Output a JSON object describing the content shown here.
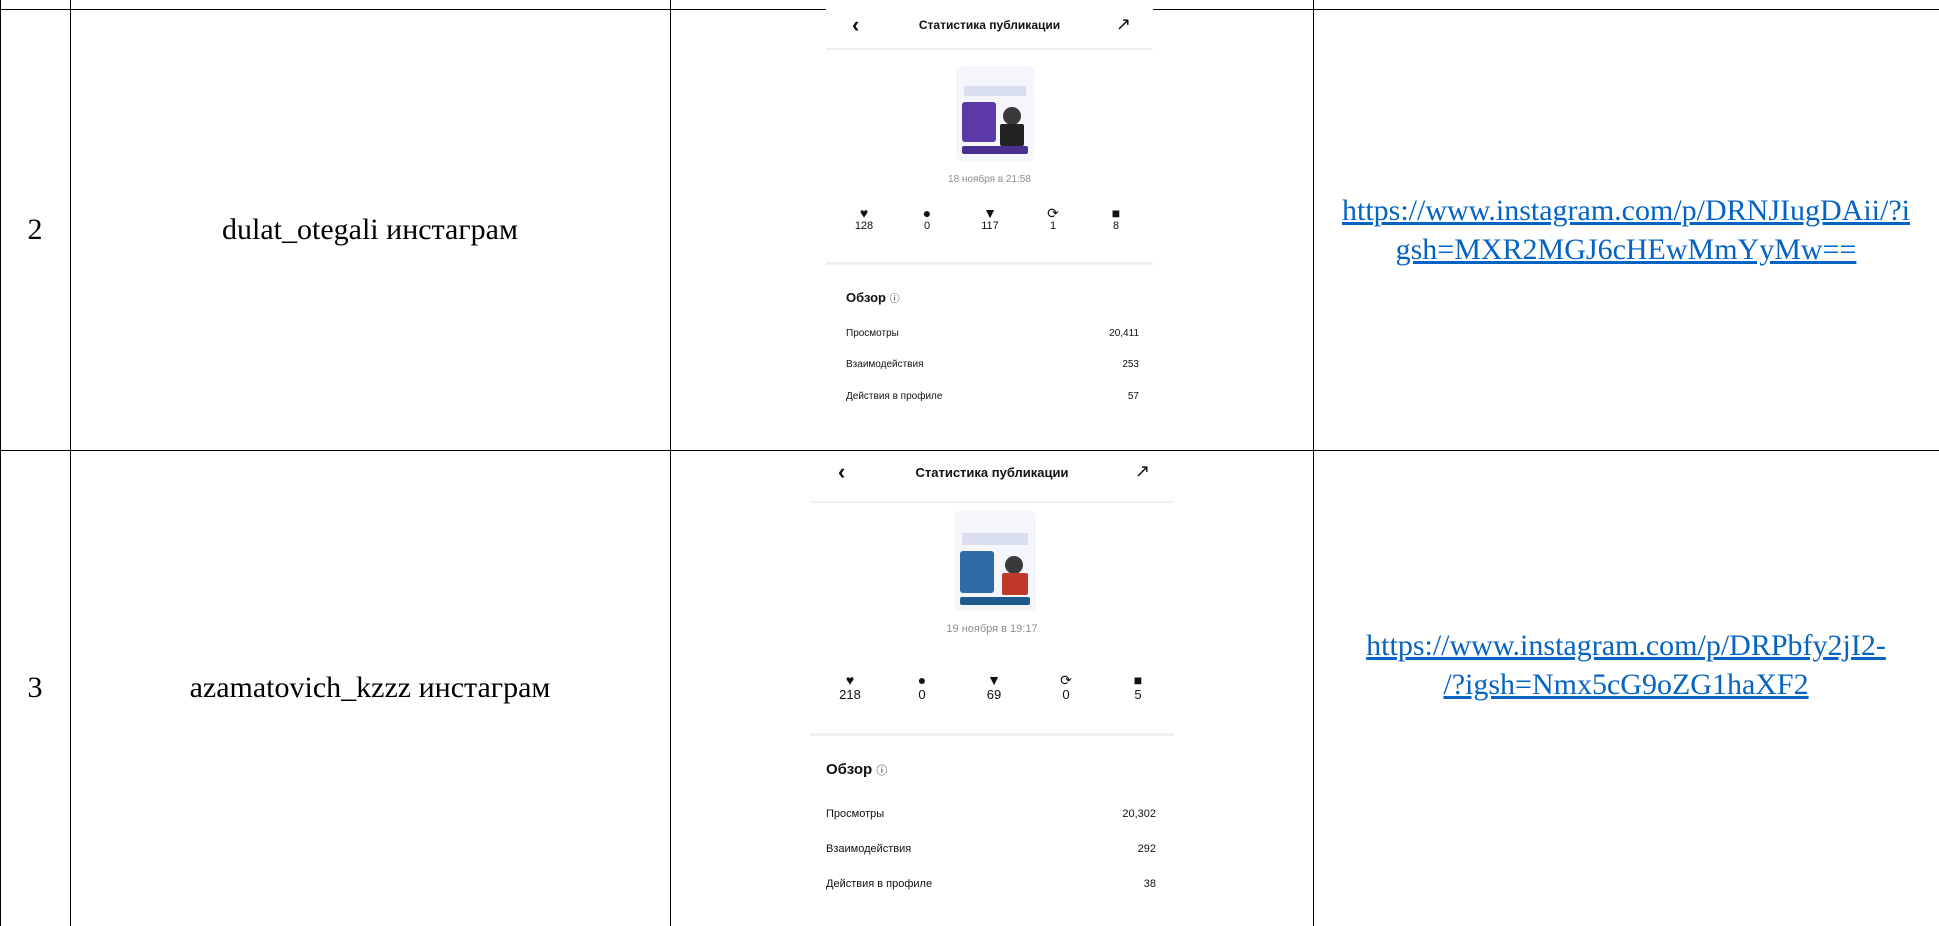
{
  "rows": [
    {
      "number": "2",
      "name": "dulat_otegali инстаграм",
      "link_line1": "https://www.instagram.com/p/DRNJIugDAii/?i",
      "link_line2": "gsh=MXR2MGJ6cHEwMmYyMw==",
      "screenshot": {
        "title": "Статистика публикации",
        "date": "18 ноября в 21:58",
        "stats": [
          "128",
          "0",
          "117",
          "1",
          "8"
        ],
        "overview_title": "Обзор",
        "overview_rows": [
          {
            "label": "Просмотры",
            "value": "20,411"
          },
          {
            "label": "Взаимодействия",
            "value": "253"
          },
          {
            "label": "Действия в профиле",
            "value": "57"
          }
        ]
      }
    },
    {
      "number": "3",
      "name": "azamatovich_kzzz инстаграм",
      "link_line1": "https://www.instagram.com/p/DRPbfy2jI2-",
      "link_line2": "/?igsh=Nmx5cG9oZG1haXF2",
      "screenshot": {
        "title": "Статистика публикации",
        "date": "19 ноября в 19:17",
        "stats": [
          "218",
          "0",
          "69",
          "0",
          "5"
        ],
        "overview_title": "Обзор",
        "overview_rows": [
          {
            "label": "Просмотры",
            "value": "20,302"
          },
          {
            "label": "Взаимодействия",
            "value": "292"
          },
          {
            "label": "Действия в профиле",
            "value": "38"
          }
        ]
      }
    }
  ],
  "icons": {
    "back": "chevron-left-icon",
    "trend": "trend-up-icon",
    "stat_icons": [
      "heart-icon",
      "comment-icon",
      "share-icon",
      "repost-icon",
      "bookmark-icon"
    ],
    "info": "info-icon"
  },
  "colors": {
    "link": "#0563c1",
    "muted": "#8e8e8e",
    "border": "#000000"
  }
}
